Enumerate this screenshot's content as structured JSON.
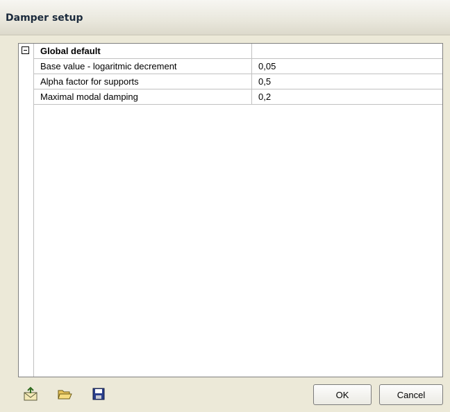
{
  "window": {
    "title": "Damper setup"
  },
  "grid": {
    "group_label": "Global default",
    "group_value": "",
    "rows": [
      {
        "name": "Base value - logaritmic decrement",
        "value": "0,05"
      },
      {
        "name": "Alpha factor for supports",
        "value": "0,5"
      },
      {
        "name": "Maximal modal damping",
        "value": "0,2"
      }
    ]
  },
  "footer": {
    "icons": [
      "export-icon",
      "open-folder-icon",
      "save-icon"
    ],
    "ok_label": "OK",
    "cancel_label": "Cancel"
  }
}
